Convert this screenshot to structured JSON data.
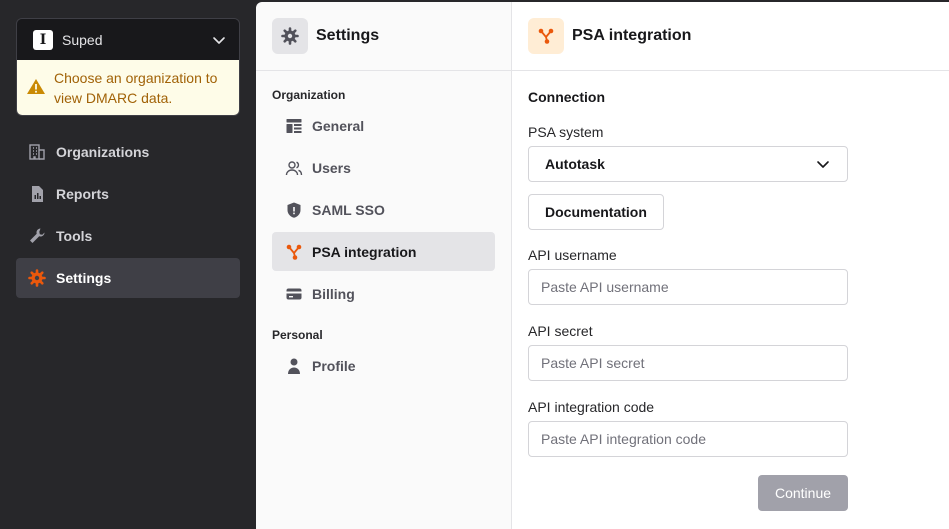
{
  "org": {
    "name": "Suped",
    "logo_letter": "I",
    "warning": "Choose an organization to view DMARC data."
  },
  "nav": [
    {
      "label": "Organizations",
      "icon": "building-icon"
    },
    {
      "label": "Reports",
      "icon": "report-icon"
    },
    {
      "label": "Tools",
      "icon": "wrench-icon"
    },
    {
      "label": "Settings",
      "icon": "gear-icon",
      "active": true
    }
  ],
  "settings": {
    "title": "Settings",
    "sections": {
      "organization": "Organization",
      "personal": "Personal"
    },
    "org_items": [
      {
        "label": "General",
        "icon": "layout-icon"
      },
      {
        "label": "Users",
        "icon": "users-icon"
      },
      {
        "label": "SAML SSO",
        "icon": "shield-icon"
      },
      {
        "label": "PSA integration",
        "icon": "integration-icon",
        "active": true
      },
      {
        "label": "Billing",
        "icon": "card-icon"
      }
    ],
    "personal_items": [
      {
        "label": "Profile",
        "icon": "user-icon"
      }
    ]
  },
  "main": {
    "title": "PSA integration",
    "section": "Connection",
    "psa_label": "PSA system",
    "psa_value": "Autotask",
    "doc_button": "Documentation",
    "username_label": "API username",
    "username_placeholder": "Paste API username",
    "secret_label": "API secret",
    "secret_placeholder": "Paste API secret",
    "code_label": "API integration code",
    "code_placeholder": "Paste API integration code",
    "continue": "Continue"
  },
  "colors": {
    "accent": "#ea580c",
    "sidebar_bg": "#27272a",
    "warning_bg": "#fefce8",
    "warning_text": "#a16207"
  }
}
